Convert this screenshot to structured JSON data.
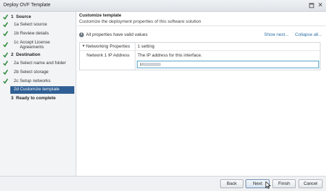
{
  "window": {
    "title": "Deploy OVF Template"
  },
  "sidebar": {
    "steps": [
      {
        "num": "1",
        "label": "Source",
        "done": true,
        "level": 1
      },
      {
        "num": "1a",
        "label": "Select source",
        "done": true,
        "level": 2
      },
      {
        "num": "1b",
        "label": "Review details",
        "done": true,
        "level": 2
      },
      {
        "num": "1c",
        "label": "Accept License",
        "label2": "Agreements",
        "done": true,
        "level": 2
      },
      {
        "num": "2",
        "label": "Destination",
        "done": true,
        "level": 1
      },
      {
        "num": "2a",
        "label": "Select name and folder",
        "done": true,
        "level": 2
      },
      {
        "num": "2b",
        "label": "Select storage",
        "done": true,
        "level": 2
      },
      {
        "num": "2c",
        "label": "Setup networks",
        "done": true,
        "level": 2
      },
      {
        "num": "2d",
        "label": "Customize template",
        "done": false,
        "active": true,
        "level": 2
      },
      {
        "num": "3",
        "label": "Ready to complete",
        "done": false,
        "level": 1
      }
    ]
  },
  "main": {
    "title": "Customize template",
    "subtitle": "Customize the deployment properties of this software solution",
    "info_text": "All properties have valid values",
    "show_next": "Show next...",
    "collapse_all": "Collapse all...",
    "group": {
      "name": "Networking Properties",
      "count": "1 setting"
    },
    "property": {
      "name": "Network 1 IP Address",
      "description": "The IP address for this interface.",
      "value": "10."
    }
  },
  "footer": {
    "back": "Back",
    "next": "Next",
    "finish": "Finish",
    "cancel": "Cancel"
  },
  "colors": {
    "accent": "#2f5f95",
    "check": "#2e8b3c",
    "link": "#2a6ea6",
    "input_border": "#4fa3c9"
  }
}
